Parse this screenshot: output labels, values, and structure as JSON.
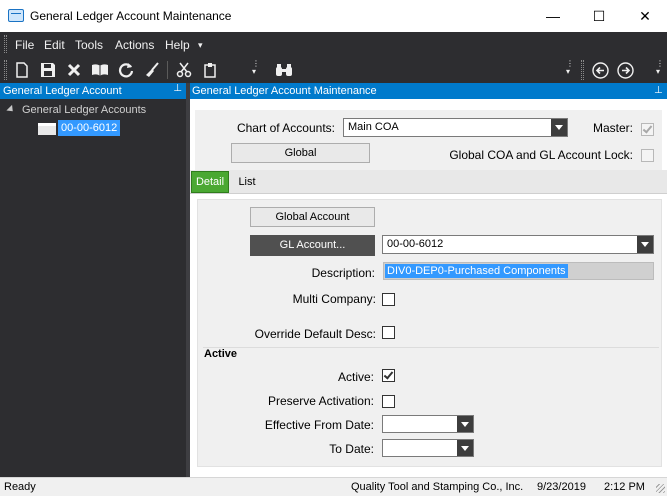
{
  "window": {
    "title": "General Ledger Account Maintenance",
    "minimize_glyph": "—",
    "maximize_glyph": "☐",
    "close_glyph": "✕"
  },
  "menu": {
    "items": [
      "File",
      "Edit",
      "Tools",
      "Actions",
      "Help"
    ]
  },
  "toolbar": {
    "icons": [
      "new-icon",
      "save-icon",
      "delete-icon",
      "open-book-icon",
      "refresh-icon",
      "clear-icon",
      "cut-icon",
      "paste-icon",
      "binoculars-icon",
      "back-icon",
      "forward-icon"
    ]
  },
  "left_pane": {
    "header": "General Ledger Account",
    "pin_glyph": "⊥",
    "tree": {
      "root_label": "General Ledger Accounts",
      "selected_node": "00-00-6012"
    }
  },
  "right_pane": {
    "header": "General Ledger Account Maintenance",
    "chart_of_accounts_label": "Chart of Accounts:",
    "chart_of_accounts_value": "Main COA",
    "master_label": "Master:",
    "global_button": "Global",
    "global_lock_label": "Global COA and GL Account Lock:",
    "tabs": [
      "Detail",
      "List"
    ],
    "active_tab": "Detail",
    "detail": {
      "global_account_button": "Global Account",
      "gl_account_button": "GL Account...",
      "gl_account_value": "00-00-6012",
      "description_label": "Description:",
      "description_value": "DIV0-DEP0-Purchased Components",
      "multi_company_label": "Multi Company:",
      "override_desc_label": "Override Default Desc:",
      "active_section_title": "Active",
      "active_label": "Active:",
      "active_checked": true,
      "preserve_activation_label": "Preserve Activation:",
      "effective_from_label": "Effective From Date:",
      "to_date_label": "To Date:",
      "effective_from_value": "",
      "to_date_value": ""
    }
  },
  "status_bar": {
    "status": "Ready",
    "company": "Quality Tool and Stamping Co., Inc.",
    "date": "9/23/2019",
    "time": "2:12 PM"
  }
}
